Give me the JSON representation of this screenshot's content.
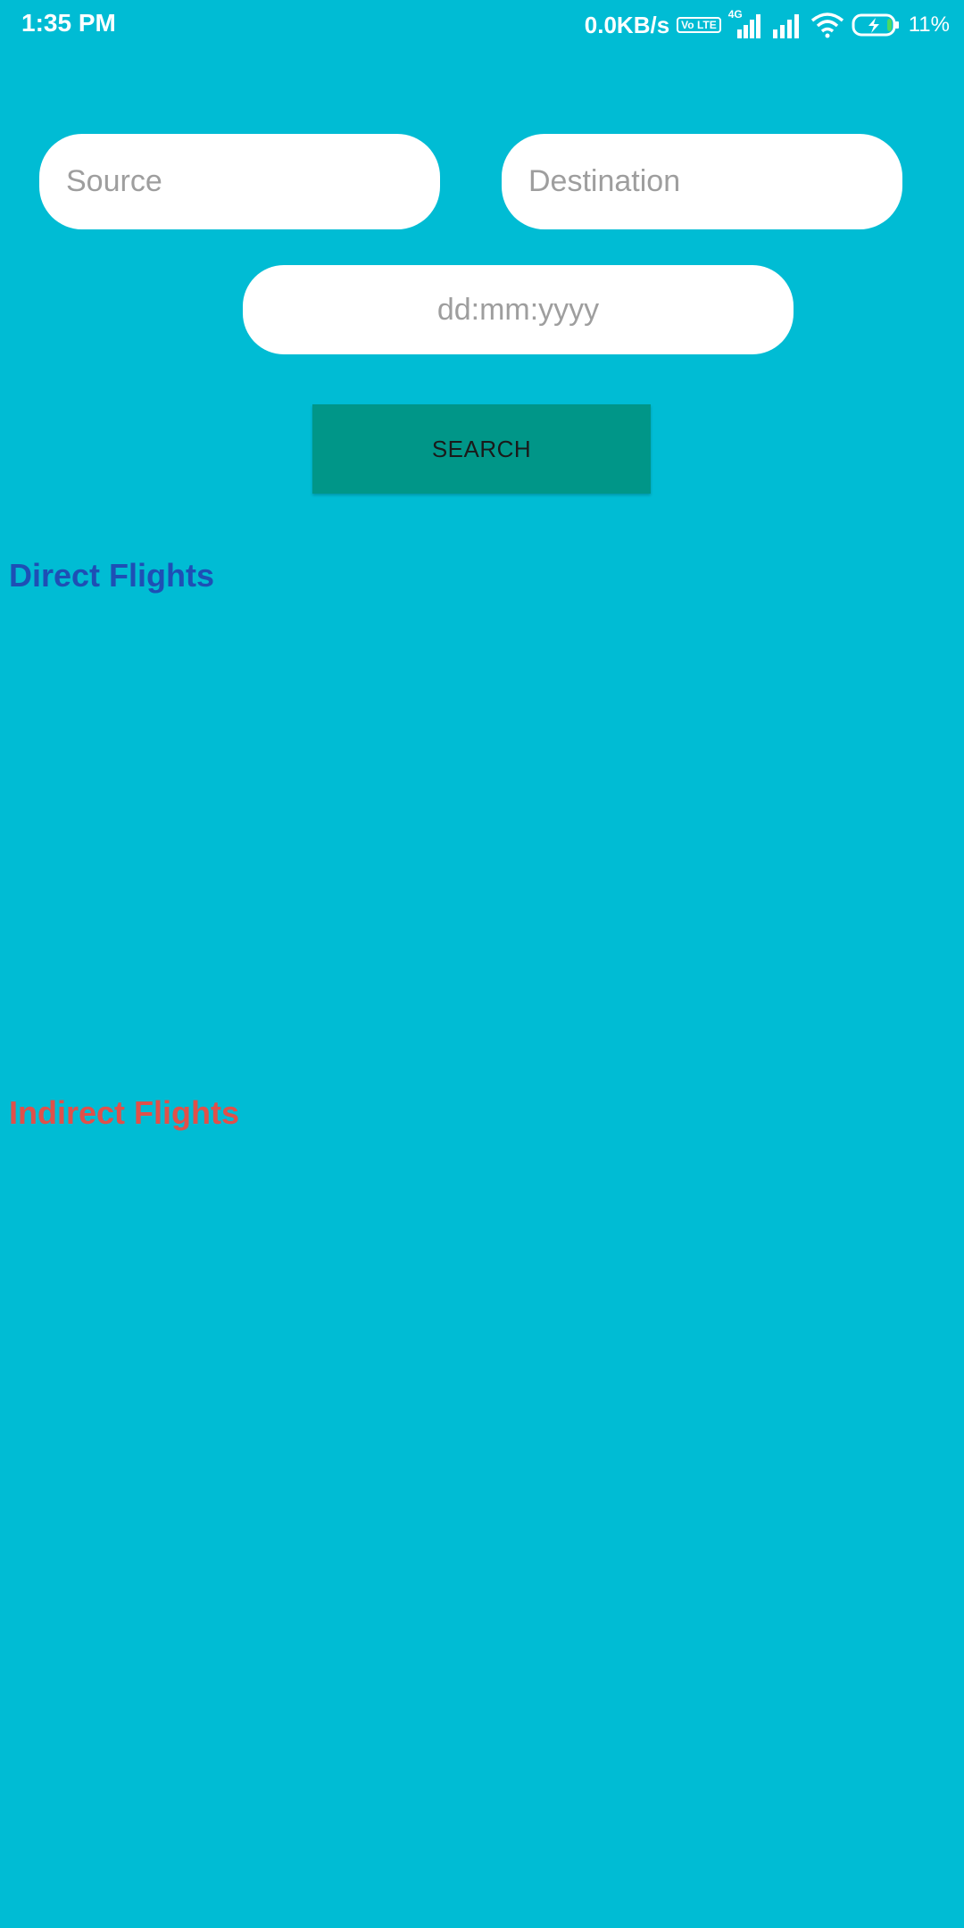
{
  "status_bar": {
    "time": "1:35 PM",
    "network_speed": "0.0KB/s",
    "volte_label": "Vo LTE",
    "network_type": "4G",
    "battery_percent": "11%",
    "icons": [
      "volte-icon",
      "signal-icon",
      "signal-icon",
      "wifi-icon",
      "battery-charging-icon"
    ]
  },
  "form": {
    "source_placeholder": "Source",
    "destination_placeholder": "Destination",
    "date_placeholder": "dd:mm:yyyy",
    "search_label": "SEARCH"
  },
  "sections": {
    "direct_title": "Direct Flights",
    "indirect_title": "Indirect Flights"
  },
  "colors": {
    "background": "#00BCD4",
    "button": "#009688",
    "direct_title": "#1E4FB5",
    "indirect_title": "#E0504A"
  }
}
